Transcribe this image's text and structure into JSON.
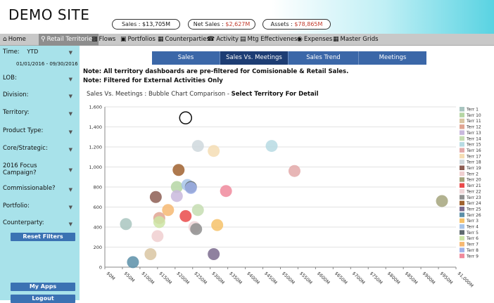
{
  "site": {
    "title": "DEMO SITE"
  },
  "kpis": {
    "sales_label": "Sales : ",
    "sales_value": "$13,705M",
    "net_label": "Net Sales : ",
    "net_value": "$2,627M",
    "assets_label": "Assets : ",
    "assets_value": "$78,865M"
  },
  "nav": {
    "items": [
      "Home",
      "Retail Territories",
      "Flows",
      "Portfolios",
      "Counterparties",
      "Activity",
      "Mtg Effectiveness",
      "Expenses",
      "Master Grids"
    ],
    "icons": [
      "home-icon",
      "map-pin-icon",
      "bar-chart-icon",
      "briefcase-icon",
      "building-icon",
      "phone-icon",
      "monitor-icon",
      "camera-icon",
      "grid-icon"
    ]
  },
  "filters": {
    "time_label": "Time:",
    "time_value": "YTD",
    "date_range": "01/01/2016 - 09/30/2016",
    "lob": "LOB:",
    "division": "Division:",
    "territory": "Territory:",
    "product_type": "Product Type:",
    "core_strategic": "Core/Strategic:",
    "focus_campaign": "2016 Focus Campaign?",
    "commissionable": "Commissionable?",
    "portfolio": "Portfolio:",
    "counterparty": "Counterparty:"
  },
  "buttons": {
    "reset_filters": "Reset Filters",
    "my_apps": "My Apps",
    "logout": "Logout"
  },
  "tabs": [
    "Sales",
    "Sales Vs. Meetings",
    "Sales Trend",
    "Meetings"
  ],
  "active_tab": "Sales Vs. Meetings",
  "notes": {
    "line1": "Note: All territory dashboards are pre-filtered for Comisionable & Retail Sales.",
    "line2": "Note: Filtered for External Activities Only"
  },
  "chart_heading": {
    "prefix": "Sales Vs. Meetings : Bubble Chart Comparison - ",
    "bold": "Select Territory For Detail"
  },
  "chart_data": {
    "type": "scatter",
    "xlim": [
      0,
      1000
    ],
    "ylim": [
      0,
      1600
    ],
    "x_ticks": [
      "$0M",
      "$50M",
      "$100M",
      "$150M",
      "$200M",
      "$250M",
      "$300M",
      "$350M",
      "$400M",
      "$450M",
      "$500M",
      "$550M",
      "$600M",
      "$650M",
      "$700M",
      "$750M",
      "$800M",
      "$850M",
      "$900M",
      "$950M",
      "$1,000M"
    ],
    "y_ticks": [
      0,
      200,
      400,
      600,
      800,
      1000,
      1200,
      1400,
      1600
    ],
    "grid": true,
    "legend_position": "right",
    "highlight": {
      "x": 230,
      "y": 1490
    },
    "series": [
      {
        "name": "Terr 1",
        "color": "#a9c5c0",
        "x": 60,
        "y": 430
      },
      {
        "name": "Terr 10",
        "color": "#b5d6a4",
        "x": 205,
        "y": 800
      },
      {
        "name": "Terr 11",
        "color": "#d9c6a2",
        "x": 130,
        "y": 130
      },
      {
        "name": "Terr 12",
        "color": "#e0a592",
        "x": 155,
        "y": 490
      },
      {
        "name": "Terr 13",
        "color": "#c9b9dd",
        "x": 205,
        "y": 710
      },
      {
        "name": "Terr 14",
        "color": "#c6ddb2",
        "x": 265,
        "y": 570
      },
      {
        "name": "Terr 15",
        "color": "#b7dbe3",
        "x": 475,
        "y": 1210
      },
      {
        "name": "Terr 16",
        "color": "#e3a9a9",
        "x": 540,
        "y": 960
      },
      {
        "name": "Terr 17",
        "color": "#f5ddb4",
        "x": 310,
        "y": 1160
      },
      {
        "name": "Terr 18",
        "color": "#cfd8dd",
        "x": 265,
        "y": 1210
      },
      {
        "name": "Terr 19",
        "color": "#8d5e54",
        "x": 145,
        "y": 700
      },
      {
        "name": "Terr 2",
        "color": "#f0cfd0",
        "x": 150,
        "y": 310
      },
      {
        "name": "Terr 20",
        "color": "#a4a47c",
        "x": 960,
        "y": 660
      },
      {
        "name": "Terr 21",
        "color": "#ea4a4a",
        "x": 230,
        "y": 510
      },
      {
        "name": "Terr 22",
        "color": "#efd6d8",
        "x": 255,
        "y": 400
      },
      {
        "name": "Terr 23",
        "color": "#8e8e8e",
        "x": 260,
        "y": 380
      },
      {
        "name": "Terr 24",
        "color": "#a0622f",
        "x": 210,
        "y": 970
      },
      {
        "name": "Terr 25",
        "color": "#7b6b8e",
        "x": 310,
        "y": 130
      },
      {
        "name": "Terr 26",
        "color": "#5b8fa8",
        "x": 80,
        "y": 50
      },
      {
        "name": "Terr 3",
        "color": "#f6c26a",
        "x": 320,
        "y": 420
      },
      {
        "name": "Terr 4",
        "color": "#a8c4e8",
        "x": 235,
        "y": 820
      },
      {
        "name": "Terr 5",
        "color": "#5f6a6e",
        "x": 245,
        "y": 800
      },
      {
        "name": "Terr 6",
        "color": "#cde5a5",
        "x": 155,
        "y": 450
      },
      {
        "name": "Terr 7",
        "color": "#f6b872",
        "x": 180,
        "y": 570
      },
      {
        "name": "Terr 8",
        "color": "#9fb2ea",
        "x": 245,
        "y": 790
      },
      {
        "name": "Terr 9",
        "color": "#f08a9c",
        "x": 345,
        "y": 760
      }
    ]
  }
}
